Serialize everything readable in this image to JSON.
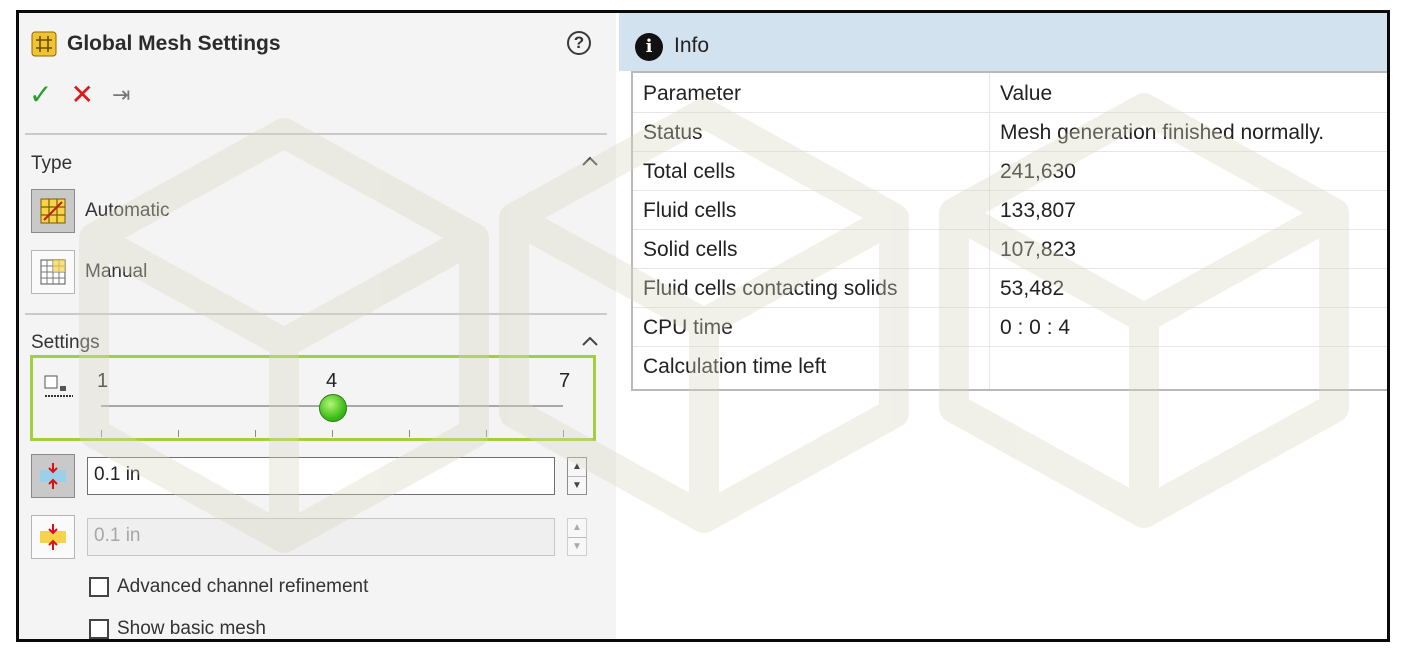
{
  "panel": {
    "title": "Global Mesh Settings",
    "help_icon": "?",
    "actions": {
      "ok": "✓",
      "cancel": "✕",
      "pin": "⇥"
    }
  },
  "type_section": {
    "title": "Type",
    "options": [
      {
        "label": "Automatic",
        "selected": true
      },
      {
        "label": "Manual",
        "selected": false
      }
    ]
  },
  "settings_section": {
    "title": "Settings",
    "slider": {
      "min_label": "1",
      "value_label": "4",
      "max_label": "7",
      "min": 1,
      "max": 7,
      "value": 4
    },
    "min_gap": {
      "value": "0.1 in"
    },
    "min_wall_thickness": {
      "value": "0.1 in"
    },
    "checkboxes": [
      {
        "label": "Advanced channel refinement",
        "checked": false
      },
      {
        "label": "Show basic mesh",
        "checked": false
      }
    ]
  },
  "info_panel": {
    "title": "Info",
    "columns": [
      "Parameter",
      "Value"
    ],
    "rows": [
      [
        "Status",
        "Mesh generation finished normally."
      ],
      [
        "Total cells",
        "241,630"
      ],
      [
        "Fluid cells",
        "133,807"
      ],
      [
        "Solid cells",
        "107,823"
      ],
      [
        "Fluid cells contacting solids",
        "53,482"
      ],
      [
        "CPU time",
        "0 : 0 : 4"
      ],
      [
        "Calculation time left",
        ""
      ]
    ]
  },
  "colors": {
    "accent_green": "#a4cf3c",
    "header_blue": "#d3e2ef"
  }
}
